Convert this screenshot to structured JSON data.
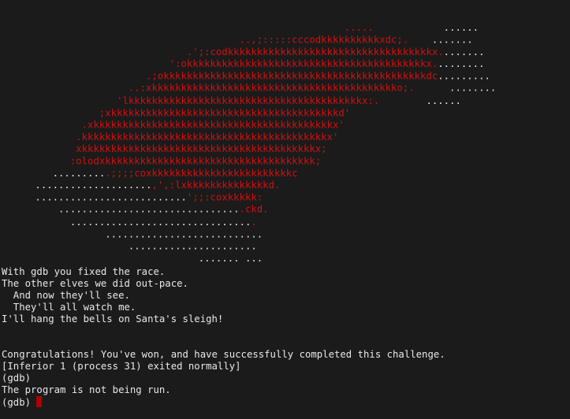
{
  "colors": {
    "background": "#1b1b1b",
    "text": "#e8e8e8",
    "art_red": "#d01010",
    "cursor": "#b00000"
  },
  "art": [
    [
      {
        "c": "r",
        "t": "                                                           .....      "
      },
      {
        "c": "w",
        "t": "      ......"
      }
    ],
    [
      {
        "c": "r",
        "t": "                                         ..,;:::::cccodkkkkkkkkkkxdc;.   "
      },
      {
        "c": "w",
        "t": " ......."
      }
    ],
    [
      {
        "c": "r",
        "t": "                                .';:codkkkkkkkkkkkkkkkkkkkkkkkkkkkkkkkkkkkx."
      },
      {
        "c": "w",
        "t": "......."
      }
    ],
    [
      {
        "c": "r",
        "t": "                             ':okkkkkkkkkkkkkkkkkkkkkkkkkkkkkkkkkkkkkkkkkx."
      },
      {
        "c": "w",
        "t": "........"
      }
    ],
    [
      {
        "c": "r",
        "t": "                         .;okkkkkkkkkkkkkkkkkkkkkkkkkkkkkkkkkkkkkkkkkkkkkdc"
      },
      {
        "c": "w",
        "t": "........."
      }
    ],
    [
      {
        "c": "r",
        "t": "                      ..:xkkkkkkkkkkkkkkkkkkkkkkkkkkkkkkkkkkkkkkkkkko;.     "
      },
      {
        "c": "w",
        "t": " ........"
      }
    ],
    [
      {
        "c": "r",
        "t": "                    'lkkkkkkkkkkkkkkkkkkkkkkkkkkkkkkkkkkkkkkkkx:.        "
      },
      {
        "c": "w",
        "t": "......"
      }
    ],
    [
      {
        "c": "r",
        "t": "                 ;xkkkkkkkkkkkkkkkkkkkkkkkkkkkkkkkkkkkkkkkd'"
      }
    ],
    [
      {
        "c": "r",
        "t": "              .xkkkkkkkkkkkkkkkkkkkkkkkkkkkkkkkkkkkkkkkkkx'"
      }
    ],
    [
      {
        "c": "r",
        "t": "             .kkkkkkkkkkkkkkkkkkkkkkkkkkkkkkkkkkkkkkkkkkx'"
      }
    ],
    [
      {
        "c": "r",
        "t": "             xkkkkkkkkkkkkkkkkkkkkkkkkkkkkkkkkkkkkkkkkx;"
      }
    ],
    [
      {
        "c": "r",
        "t": "            :olodxkkkkkkkkkkkkkkkkkkkkkkkkkkkkkkkkkkkk;"
      }
    ],
    [
      {
        "c": "w",
        "t": "         ........."
      },
      {
        "c": "r",
        "t": ".;;;;coxkkkkkkkkkkkkkkkkkkkkkkkkc"
      }
    ],
    [
      {
        "c": "w",
        "t": "      ...................."
      },
      {
        "c": "r",
        "t": ",',:lxkkkkkkkkkkkkkkd."
      }
    ],
    [
      {
        "c": "w",
        "t": "      .........................."
      },
      {
        "c": "r",
        "t": "';;:coxkkkkk:"
      }
    ],
    [
      {
        "c": "w",
        "t": "          ..............................."
      },
      {
        "c": "r",
        "t": ".ckd."
      }
    ],
    [
      {
        "c": "w",
        "t": "            ..............................."
      },
      {
        "c": "r",
        "t": "."
      }
    ],
    [
      {
        "c": "w",
        "t": "                  ..........................."
      }
    ],
    [
      {
        "c": "w",
        "t": "                      ......................"
      }
    ],
    [
      {
        "c": "w",
        "t": "                                  ....... ..."
      }
    ]
  ],
  "output_lines": [
    "With gdb you fixed the race.",
    "The other elves we did out-pace.",
    "  And now they'll see.",
    "  They'll all watch me.",
    "I'll hang the bells on Santa's sleigh!",
    "",
    "",
    "Congratulations! You've won, and have successfully completed this challenge.",
    "[Inferior 1 (process 31) exited normally]",
    "(gdb)",
    "The program is not being run."
  ],
  "prompt": "(gdb) "
}
